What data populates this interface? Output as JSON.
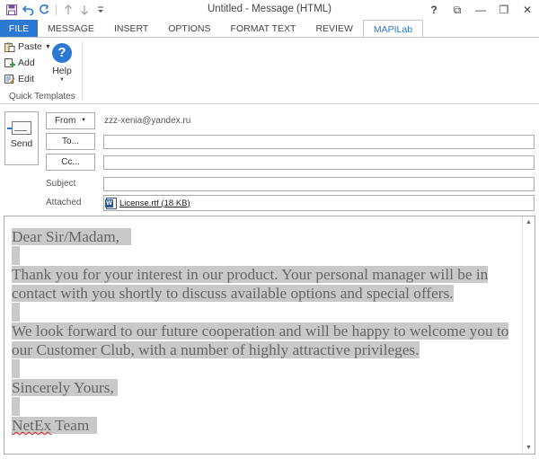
{
  "window": {
    "title": "Untitled - Message (HTML)",
    "help_label": "?",
    "controls": {
      "options": "⧉",
      "minimize": "—",
      "restore": "❐",
      "close": "✕"
    }
  },
  "quick_access": [
    "save-icon",
    "undo-icon",
    "redo-icon",
    "up-icon",
    "down-icon",
    "customize-icon"
  ],
  "tabs": [
    {
      "label": "FILE"
    },
    {
      "label": "MESSAGE"
    },
    {
      "label": "INSERT"
    },
    {
      "label": "OPTIONS"
    },
    {
      "label": "FORMAT TEXT"
    },
    {
      "label": "REVIEW"
    },
    {
      "label": "MAPILab"
    }
  ],
  "ribbon": {
    "paste_label": "Paste",
    "add_label": "Add",
    "edit_label": "Edit",
    "help_label": "Help",
    "group_label": "Quick Templates"
  },
  "header": {
    "send_label": "Send",
    "from_label": "From",
    "from_value": "zzz-xenia@yandex.ru",
    "to_label": "To...",
    "cc_label": "Cc...",
    "subject_label": "Subject",
    "attached_label": "Attached",
    "attachment_name": "License.rtf (18 KB)"
  },
  "body": {
    "greeting": "Dear Sir/Madam,",
    "para1": "Thank you for your interest in our product. Your personal manager will be in contact with you shortly to discuss available options and special offers.",
    "para2": "We look forward to our future cooperation and will be happy to welcome you to our Customer Club, with a number of highly attractive privileges.",
    "closing": "Sincerely Yours,",
    "signature_word1": "NetEx",
    "signature_word2": " Team"
  },
  "colors": {
    "accent": "#2b79d3",
    "highlight": "#c9c9c9",
    "body_text": "#666666"
  }
}
